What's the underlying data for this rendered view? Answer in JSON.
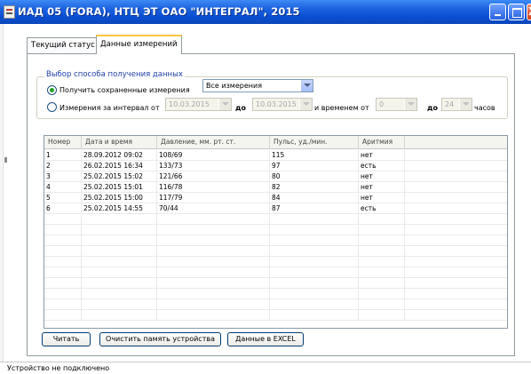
{
  "window": {
    "title": "ИАД 05 (FORA), НТЦ ЭТ ОАО \"ИНТЕГРАЛ\", 2015"
  },
  "tabs": [
    {
      "label": "Текущий статус",
      "active": false
    },
    {
      "label": "Данные измерений",
      "active": true
    }
  ],
  "selection": {
    "legend": "Выбор способа получения данных",
    "option_saved": {
      "label": "Получить сохраненные измерения",
      "checked": true
    },
    "saved_select": {
      "value": "Все измерения"
    },
    "option_interval": {
      "label": "Измерения за интервал от",
      "checked": false
    },
    "date_from": "10.03.2015",
    "label_to": "до",
    "date_to": "10.03.2015",
    "label_time_from": "и временем от",
    "time_from": "0",
    "label_time_to": "до",
    "time_to": "24",
    "label_hours": "часов"
  },
  "table": {
    "columns": [
      "Номер",
      "Дата и время",
      "Давление, мм. рт. ст.",
      "Пульс, уд./мин.",
      "Аритмия"
    ],
    "rows": [
      [
        "1",
        "28.09.2012 09:02",
        "108/69",
        "115",
        "нет"
      ],
      [
        "2",
        "26.02.2015 16:34",
        "133/73",
        "97",
        "есть"
      ],
      [
        "3",
        "25.02.2015 15:02",
        "121/66",
        "80",
        "нет"
      ],
      [
        "4",
        "25.02.2015 15:01",
        "116/78",
        "82",
        "нет"
      ],
      [
        "5",
        "25.02.2015 15:00",
        "117/79",
        "84",
        "нет"
      ],
      [
        "6",
        "25.02.2015 14:55",
        "70/44",
        "87",
        "есть"
      ]
    ]
  },
  "buttons": {
    "read": "Читать",
    "clear_memory": "Очистить память устройства",
    "export_excel": "Данные в EXCEL"
  },
  "status_bar": {
    "text": "Устройство не подключено"
  }
}
